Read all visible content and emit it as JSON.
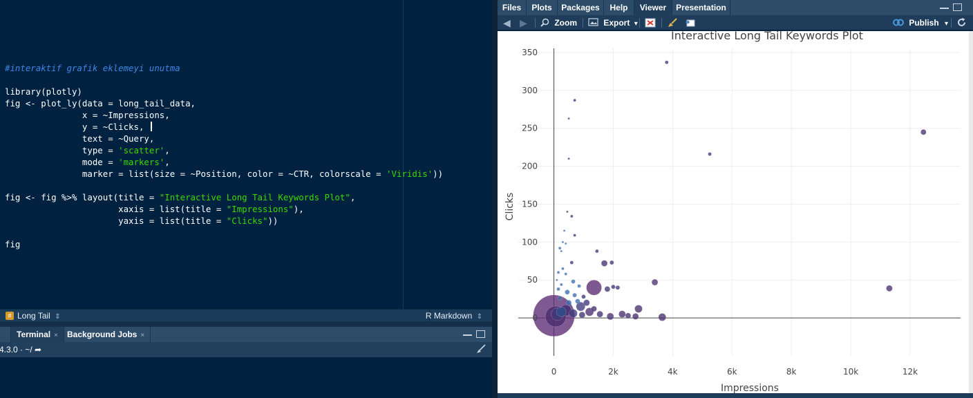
{
  "editor": {
    "lines": [
      {
        "parts": [
          {
            "t": "",
            "c": ""
          }
        ]
      },
      {
        "parts": [
          {
            "t": "#interaktif grafik eklemeyi unutma",
            "c": "cmt"
          }
        ]
      },
      {
        "parts": [
          {
            "t": "",
            "c": ""
          }
        ]
      },
      {
        "parts": [
          {
            "t": "library(plotly)",
            "c": ""
          }
        ]
      },
      {
        "parts": [
          {
            "t": "fig <- plot_ly(data = long_tail_data,",
            "c": ""
          }
        ]
      },
      {
        "parts": [
          {
            "t": "               x = ~Impressions,",
            "c": ""
          }
        ]
      },
      {
        "parts": [
          {
            "t": "               y = ~Clicks, ",
            "c": ""
          }
        ],
        "cursor": true
      },
      {
        "parts": [
          {
            "t": "               text = ~Query,",
            "c": ""
          }
        ]
      },
      {
        "parts": [
          {
            "t": "               type = ",
            "c": ""
          },
          {
            "t": "'scatter'",
            "c": "str"
          },
          {
            "t": ",",
            "c": ""
          }
        ]
      },
      {
        "parts": [
          {
            "t": "               mode = ",
            "c": ""
          },
          {
            "t": "'markers'",
            "c": "str"
          },
          {
            "t": ",",
            "c": ""
          }
        ]
      },
      {
        "parts": [
          {
            "t": "               marker = list(size = ~Position, color = ~CTR, colorscale = ",
            "c": ""
          },
          {
            "t": "'Viridis'",
            "c": "str"
          },
          {
            "t": "))",
            "c": ""
          }
        ]
      },
      {
        "parts": [
          {
            "t": "",
            "c": ""
          }
        ]
      },
      {
        "parts": [
          {
            "t": "fig <- fig %>% layout(title = ",
            "c": ""
          },
          {
            "t": "\"Interactive Long Tail Keywords Plot\"",
            "c": "str"
          },
          {
            "t": ",",
            "c": ""
          }
        ]
      },
      {
        "parts": [
          {
            "t": "                      xaxis = list(title = ",
            "c": ""
          },
          {
            "t": "\"Impressions\"",
            "c": "str"
          },
          {
            "t": "),",
            "c": ""
          }
        ]
      },
      {
        "parts": [
          {
            "t": "                      yaxis = list(title = ",
            "c": ""
          },
          {
            "t": "\"Clicks\"",
            "c": "str"
          },
          {
            "t": "))",
            "c": ""
          }
        ]
      },
      {
        "parts": [
          {
            "t": "",
            "c": ""
          }
        ]
      },
      {
        "parts": [
          {
            "t": "fig",
            "c": ""
          }
        ]
      }
    ],
    "status": {
      "doc_name": "Long Tail",
      "doc_arrow": "⇕",
      "language": "R Markdown",
      "language_arrow": "⇕"
    }
  },
  "console": {
    "tabs": [
      {
        "label": "Terminal",
        "close": "×"
      },
      {
        "label": "Background Jobs",
        "close": "×"
      }
    ],
    "path": "4.3.0  ·  ~/  ➦"
  },
  "right_pane": {
    "tabs": [
      "Files",
      "Plots",
      "Packages",
      "Help",
      "Viewer",
      "Presentation"
    ],
    "active_tab": "Viewer",
    "toolbar": {
      "zoom": "Zoom",
      "export": "Export",
      "export_arrow": "▾",
      "publish": "Publish",
      "publish_arrow": "▾"
    }
  },
  "chart_data": {
    "type": "scatter",
    "title": "Interactive Long Tail Keywords Plot",
    "xlabel": "Impressions",
    "ylabel": "Clicks",
    "xlim": [
      -1200,
      13700
    ],
    "ylim": [
      -50,
      360
    ],
    "x_ticks": [
      0,
      2000,
      4000,
      6000,
      8000,
      10000,
      12000
    ],
    "x_tick_labels": [
      "0",
      "2k",
      "4k",
      "6k",
      "8k",
      "10k",
      "12k"
    ],
    "y_ticks": [
      0,
      50,
      100,
      150,
      200,
      250,
      300,
      350
    ],
    "y_tick_labels": [
      "0",
      "50",
      "100",
      "150",
      "200",
      "250",
      "300",
      "350"
    ],
    "grid": true,
    "points": [
      {
        "x": 0,
        "y": 3,
        "size": 60,
        "color": "#5b2a73"
      },
      {
        "x": 60,
        "y": 2,
        "size": 30,
        "color": "#4a2b6e"
      },
      {
        "x": 120,
        "y": 5,
        "size": 18,
        "color": "#3f3a7a"
      },
      {
        "x": 250,
        "y": 8,
        "size": 14,
        "color": "#2f4f8a"
      },
      {
        "x": 400,
        "y": 10,
        "size": 16,
        "color": "#402c6e"
      },
      {
        "x": 650,
        "y": 6,
        "size": 12,
        "color": "#3b3a7a"
      },
      {
        "x": 900,
        "y": 15,
        "size": 13,
        "color": "#3f3a7a"
      },
      {
        "x": 1200,
        "y": 8,
        "size": 12,
        "color": "#4b2f6f"
      },
      {
        "x": 1350,
        "y": 40,
        "size": 22,
        "color": "#5a2a72"
      },
      {
        "x": 1550,
        "y": 5,
        "size": 9,
        "color": "#443270"
      },
      {
        "x": 1700,
        "y": 72,
        "size": 9,
        "color": "#4a3272"
      },
      {
        "x": 1800,
        "y": 38,
        "size": 8,
        "color": "#3d3878"
      },
      {
        "x": 1900,
        "y": 2,
        "size": 10,
        "color": "#4a2f6f"
      },
      {
        "x": 1950,
        "y": 73,
        "size": 6,
        "color": "#3d3878"
      },
      {
        "x": 2000,
        "y": 41,
        "size": 6,
        "color": "#3d3878"
      },
      {
        "x": 2150,
        "y": 40,
        "size": 6,
        "color": "#3d3878"
      },
      {
        "x": 2300,
        "y": 5,
        "size": 10,
        "color": "#4a2f6f"
      },
      {
        "x": 2500,
        "y": 3,
        "size": 8,
        "color": "#443270"
      },
      {
        "x": 2750,
        "y": 2,
        "size": 9,
        "color": "#4a2f6f"
      },
      {
        "x": 2850,
        "y": 12,
        "size": 11,
        "color": "#4a2f6f"
      },
      {
        "x": 3400,
        "y": 47,
        "size": 9,
        "color": "#4a3272"
      },
      {
        "x": 3650,
        "y": 1,
        "size": 11,
        "color": "#4a2f6f"
      },
      {
        "x": 3800,
        "y": 337,
        "size": 5,
        "color": "#3d3878"
      },
      {
        "x": 5250,
        "y": 216,
        "size": 5,
        "color": "#3d3878"
      },
      {
        "x": 11300,
        "y": 39,
        "size": 9,
        "color": "#4a3272"
      },
      {
        "x": 12450,
        "y": 245,
        "size": 8,
        "color": "#4a3272"
      },
      {
        "x": 500,
        "y": 263,
        "size": 3,
        "color": "#3d3878"
      },
      {
        "x": 700,
        "y": 287,
        "size": 4,
        "color": "#3d3878"
      },
      {
        "x": 500,
        "y": 210,
        "size": 3,
        "color": "#3d3878"
      },
      {
        "x": 450,
        "y": 140,
        "size": 3,
        "color": "#3d3878"
      },
      {
        "x": 600,
        "y": 134,
        "size": 4,
        "color": "#3d3878"
      },
      {
        "x": 350,
        "y": 115,
        "size": 3,
        "color": "#3d6db0"
      },
      {
        "x": 700,
        "y": 109,
        "size": 4,
        "color": "#3d3878"
      },
      {
        "x": 300,
        "y": 100,
        "size": 3,
        "color": "#3d6db0"
      },
      {
        "x": 400,
        "y": 98,
        "size": 3,
        "color": "#3d6db0"
      },
      {
        "x": 200,
        "y": 92,
        "size": 4,
        "color": "#3d6db0"
      },
      {
        "x": 250,
        "y": 88,
        "size": 3,
        "color": "#3d6db0"
      },
      {
        "x": 1450,
        "y": 88,
        "size": 5,
        "color": "#3d3878"
      },
      {
        "x": 600,
        "y": 73,
        "size": 5,
        "color": "#3d3878"
      },
      {
        "x": 300,
        "y": 65,
        "size": 4,
        "color": "#3d6db0"
      },
      {
        "x": 150,
        "y": 60,
        "size": 4,
        "color": "#3d6db0"
      },
      {
        "x": 400,
        "y": 58,
        "size": 4,
        "color": "#3d6db0"
      },
      {
        "x": 100,
        "y": 50,
        "size": 3,
        "color": "#3d6db0"
      },
      {
        "x": 650,
        "y": 48,
        "size": 6,
        "color": "#3d6db0"
      },
      {
        "x": 250,
        "y": 44,
        "size": 4,
        "color": "#3d6db0"
      },
      {
        "x": 850,
        "y": 42,
        "size": 5,
        "color": "#3d6db0"
      },
      {
        "x": 150,
        "y": 38,
        "size": 5,
        "color": "#3d6db0"
      },
      {
        "x": 450,
        "y": 34,
        "size": 7,
        "color": "#3d6db0"
      },
      {
        "x": 700,
        "y": 30,
        "size": 6,
        "color": "#3d6db0"
      },
      {
        "x": 1000,
        "y": 28,
        "size": 6,
        "color": "#3d3878"
      },
      {
        "x": 200,
        "y": 26,
        "size": 6,
        "color": "#3d6db0"
      },
      {
        "x": 1100,
        "y": 20,
        "size": 9,
        "color": "#3d3878"
      },
      {
        "x": 800,
        "y": 22,
        "size": 7,
        "color": "#3d6db0"
      },
      {
        "x": 500,
        "y": 20,
        "size": 8,
        "color": "#3d6db0"
      },
      {
        "x": 1350,
        "y": 12,
        "size": 8,
        "color": "#443270"
      },
      {
        "x": 950,
        "y": 4,
        "size": 9,
        "color": "#443270"
      }
    ]
  }
}
